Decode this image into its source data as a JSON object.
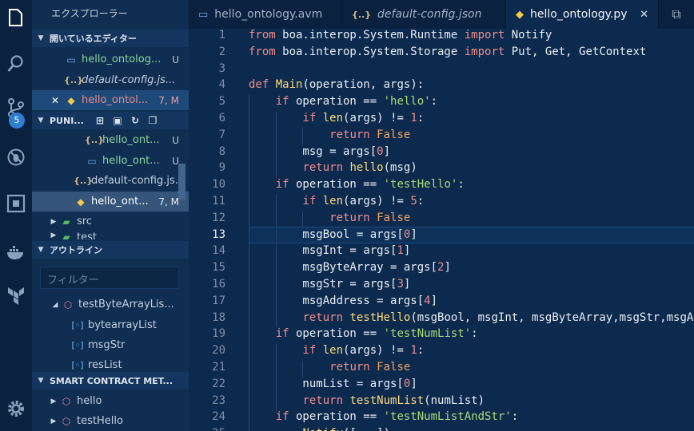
{
  "explorer_title": "エクスプローラー",
  "open_editors": {
    "title": "開いているエディター",
    "items": [
      {
        "label": "hello_ontolog...",
        "status": "U"
      },
      {
        "label": "default-config.js...",
        "status": ""
      },
      {
        "label": "hello_ontol...",
        "status": "7, M"
      }
    ]
  },
  "workspace": {
    "title": "PUNI...",
    "items": [
      {
        "label": "hello_ont...",
        "status": "U"
      },
      {
        "label": "hello_ont...",
        "status": "U"
      },
      {
        "label": "default-config.js...",
        "status": ""
      },
      {
        "label": "hello_ont...",
        "status": "7, M"
      },
      {
        "label": "src",
        "status": ""
      },
      {
        "label": "test",
        "status": ""
      }
    ]
  },
  "outline": {
    "title": "アウトライン",
    "filter_placeholder": "フィルター",
    "items": [
      "testByteArrayLis...",
      "bytearrayList",
      "msgStr",
      "resList"
    ]
  },
  "smart_contract": {
    "title": "SMART CONTRACT MET...",
    "items": [
      "hello",
      "testHello"
    ]
  },
  "scm_badge": "5",
  "tabs": [
    {
      "label": "hello_ontology.avm"
    },
    {
      "label": "default-config.json"
    },
    {
      "label": "hello_ontology.py"
    }
  ],
  "line_numbers": [
    "1",
    "2",
    "3",
    "4",
    "5",
    "6",
    "7",
    "8",
    "9",
    "10",
    "11",
    "12",
    "13",
    "14",
    "15",
    "16",
    "17",
    "18",
    "19",
    "20",
    "21",
    "22",
    "23",
    "24",
    "25"
  ],
  "code_lines": [
    "from boa.interop.System.Runtime import Notify",
    "from boa.interop.System.Storage import Put, Get, GetContext",
    "",
    "def Main(operation, args):",
    "    if operation == 'hello':",
    "        if len(args) != 1:",
    "            return False",
    "        msg = args[0]",
    "        return hello(msg)",
    "    if operation == 'testHello':",
    "        if len(args) != 5:",
    "            return False",
    "        msgBool = args[0]",
    "        msgInt = args[1]",
    "        msgByteArray = args[2]",
    "        msgStr = args[3]",
    "        msgAddress = args[4]",
    "        return testHello(msgBool, msgInt, msgByteArray,msgStr,msgAdd",
    "    if operation == 'testNumList':",
    "        if len(args) != 1:",
    "            return False",
    "        numList = args[0]",
    "        return testNumList(numList)",
    "    if operation == 'testNumListAndStr':",
    "        Notify([...])"
  ],
  "colors": {
    "background": "#0c2a4e",
    "keyword": "#f08d8d",
    "string": "#a9dc76",
    "function": "#ffd87a",
    "badge": "#2f7fd1"
  }
}
